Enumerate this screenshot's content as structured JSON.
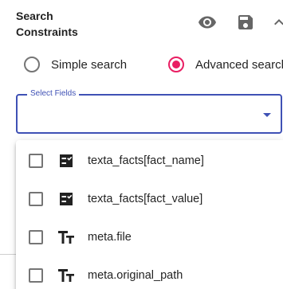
{
  "header": {
    "title_line1": "Search",
    "title_line2": "Constraints",
    "icons": [
      "eye-icon",
      "save-icon",
      "chevron-up-icon"
    ]
  },
  "search_mode": {
    "simple_label": "Simple search",
    "advanced_label": "Advanced search",
    "selected": "advanced"
  },
  "select_fields": {
    "label": "Select Fields",
    "value": ""
  },
  "options": [
    {
      "label": "texta_facts[fact_name]",
      "icon": "fact-icon",
      "checked": false
    },
    {
      "label": "texta_facts[fact_value]",
      "icon": "fact-icon",
      "checked": false
    },
    {
      "label": "meta.file",
      "icon": "text-type-icon",
      "checked": false
    },
    {
      "label": "meta.original_path",
      "icon": "text-type-icon",
      "checked": false
    }
  ],
  "colors": {
    "accent": "#e91e63",
    "primary": "#3f51b5"
  }
}
